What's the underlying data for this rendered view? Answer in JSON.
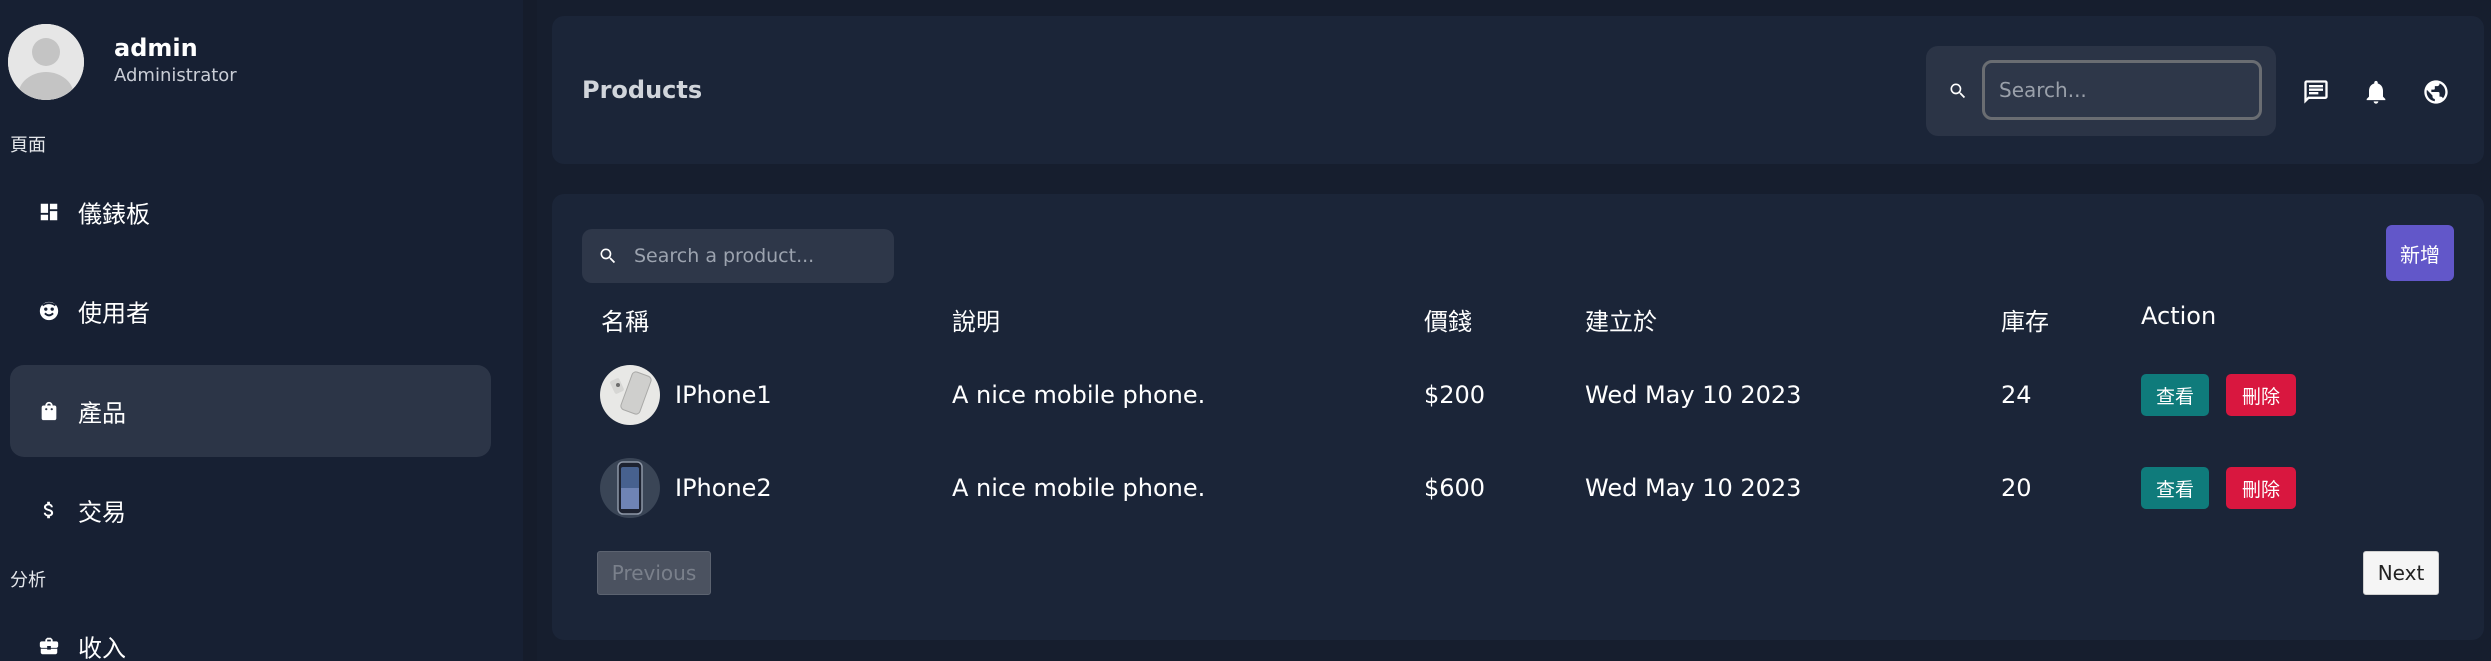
{
  "sidebar": {
    "user": {
      "name": "admin",
      "role": "Administrator"
    },
    "sections": [
      {
        "label": "頁面"
      },
      {
        "label": "分析"
      }
    ],
    "items": [
      {
        "label": "儀錶板",
        "icon": "dashboard-icon"
      },
      {
        "label": "使用者",
        "icon": "face-icon"
      },
      {
        "label": "產品",
        "icon": "shopping-bag-icon",
        "active": true
      },
      {
        "label": "交易",
        "icon": "dollar-icon"
      },
      {
        "label": "收入",
        "icon": "briefcase-icon"
      }
    ]
  },
  "header": {
    "title": "Products",
    "search_placeholder": "Search...",
    "icons": [
      "chat-icon",
      "bell-icon",
      "globe-icon"
    ]
  },
  "products": {
    "search_placeholder": "Search a product...",
    "add_label": "新增",
    "columns": [
      "名稱",
      "說明",
      "價錢",
      "建立於",
      "庫存",
      "Action"
    ],
    "rows": [
      {
        "name": "IPhone1",
        "description": "A nice mobile phone.",
        "price": "$200",
        "created": "Wed May 10 2023",
        "stock": "24",
        "view_label": "查看",
        "delete_label": "刪除"
      },
      {
        "name": "IPhone2",
        "description": "A nice mobile phone.",
        "price": "$600",
        "created": "Wed May 10 2023",
        "stock": "20",
        "view_label": "查看",
        "delete_label": "刪除"
      }
    ],
    "pagination": {
      "previous_label": "Previous",
      "next_label": "Next"
    }
  },
  "colors": {
    "page_bg": "#161e2e",
    "sidebar_bg": "#172033",
    "card_bg": "#1b2538",
    "active_nav": "#2c3547",
    "add_button": "#6257c9",
    "view_button": "#0f7b7b",
    "delete_button": "#d9173f"
  }
}
